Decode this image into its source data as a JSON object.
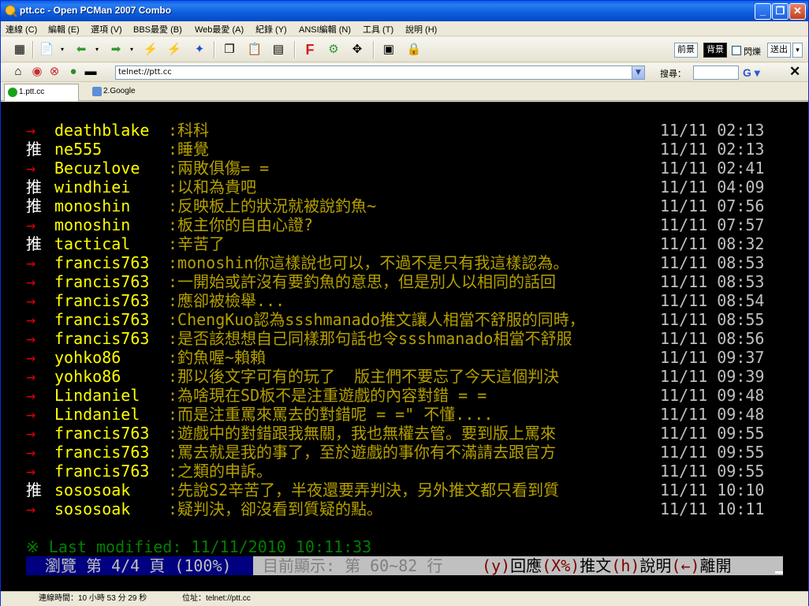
{
  "window": {
    "title": "ptt.cc - Open PCMan 2007 Combo"
  },
  "menu": [
    "連線 (C)",
    "編輯 (E)",
    "選項 (V)",
    "BBS最愛 (B)",
    "Web最愛 (A)",
    "紀錄 (Y)",
    "ANSI編輯 (N)",
    "工具 (T)",
    "說明 (H)"
  ],
  "toolbar": {
    "front_label": "前景",
    "back_label": "背景",
    "blink_label": "閃爍",
    "send_label": "送出"
  },
  "address": {
    "value": "telnet://ptt.cc",
    "search_label": "搜尋：",
    "search_value": ""
  },
  "tabs": [
    {
      "label": "1.ptt.cc",
      "active": true
    },
    {
      "label": "2.Google",
      "active": false
    }
  ],
  "terminal": {
    "rows": [
      {
        "tag": "→",
        "tag_type": "arrow",
        "user": "deathblake",
        "msg": ":科科",
        "time": "11/11 02:13"
      },
      {
        "tag": "推",
        "tag_type": "push",
        "user": "ne555",
        "msg": ":睡覺",
        "time": "11/11 02:13"
      },
      {
        "tag": "→",
        "tag_type": "arrow",
        "user": "Becuzlove",
        "msg": ":兩敗俱傷= =",
        "time": "11/11 02:41"
      },
      {
        "tag": "推",
        "tag_type": "push",
        "user": "windhiei",
        "msg": ":以和為貴吧",
        "time": "11/11 04:09"
      },
      {
        "tag": "推",
        "tag_type": "push",
        "user": "monoshin",
        "msg": ":反映板上的狀況就被說釣魚~",
        "time": "11/11 07:56"
      },
      {
        "tag": "→",
        "tag_type": "arrow",
        "user": "monoshin",
        "msg": ":板主你的自由心證?",
        "time": "11/11 07:57"
      },
      {
        "tag": "推",
        "tag_type": "push",
        "user": "tactical",
        "msg": ":辛苦了",
        "time": "11/11 08:32"
      },
      {
        "tag": "→",
        "tag_type": "arrow",
        "user": "francis763",
        "msg": ":monoshin你這樣說也可以，不過不是只有我這樣認為。",
        "time": "11/11 08:53"
      },
      {
        "tag": "→",
        "tag_type": "arrow",
        "user": "francis763",
        "msg": ":一開始或許沒有要釣魚的意思，但是別人以相同的話回",
        "time": "11/11 08:53"
      },
      {
        "tag": "→",
        "tag_type": "arrow",
        "user": "francis763",
        "msg": ":應卻被檢舉...",
        "time": "11/11 08:54"
      },
      {
        "tag": "→",
        "tag_type": "arrow",
        "user": "francis763",
        "msg": ":ChengKuo認為ssshmanado推文讓人相當不舒服的同時，",
        "time": "11/11 08:55"
      },
      {
        "tag": "→",
        "tag_type": "arrow",
        "user": "francis763",
        "msg": ":是否該想想自己同樣那句話也令ssshmanado相當不舒服",
        "time": "11/11 08:56"
      },
      {
        "tag": "→",
        "tag_type": "arrow",
        "user": "yohko86",
        "msg": ":釣魚喔~賴賴",
        "time": "11/11 09:37"
      },
      {
        "tag": "→",
        "tag_type": "arrow",
        "user": "yohko86",
        "msg": ":那以後文字可有的玩了  版主們不要忘了今天這個判決",
        "time": "11/11 09:39"
      },
      {
        "tag": "→",
        "tag_type": "arrow",
        "user": "Lindaniel",
        "msg": ":為啥現在SD板不是注重遊戲的內容對錯 = =",
        "time": "11/11 09:48"
      },
      {
        "tag": "→",
        "tag_type": "arrow",
        "user": "Lindaniel",
        "msg": ":而是注重罵來罵去的對錯呢 = =\" 不懂....",
        "time": "11/11 09:48"
      },
      {
        "tag": "→",
        "tag_type": "arrow",
        "user": "francis763",
        "msg": ":遊戲中的對錯跟我無關，我也無權去管。要到版上罵來",
        "time": "11/11 09:55"
      },
      {
        "tag": "→",
        "tag_type": "arrow",
        "user": "francis763",
        "msg": ":罵去就是我的事了，至於遊戲的事你有不滿請去跟官方",
        "time": "11/11 09:55"
      },
      {
        "tag": "→",
        "tag_type": "arrow",
        "user": "francis763",
        "msg": ":之類的申訴。",
        "time": "11/11 09:55"
      },
      {
        "tag": "推",
        "tag_type": "push",
        "user": "sososoak",
        "msg": ":先說S2辛苦了，半夜還要弄判決，另外推文都只看到質",
        "time": "11/11 10:10"
      },
      {
        "tag": "→",
        "tag_type": "arrow",
        "user": "sososoak",
        "msg": ":疑判決，卻沒看到質疑的點。",
        "time": "11/11 10:11"
      }
    ],
    "last_modified": "※ Last modified: 11/11/2010 10:11:33",
    "footer": {
      "browse": "瀏覽 第 4/4 頁 (100%)",
      "showing": "目前顯示: 第 60~82 行",
      "key_y": "(y)",
      "reply": "回應",
      "key_x": "(X%)",
      "push": "推文",
      "key_h": "(h)",
      "help": "說明",
      "key_left": "(←)",
      "leave": "離開"
    }
  },
  "status": {
    "connect_time": "連線時間：10 小時 53 分 29 秒",
    "location": "位址：telnet://ptt.cc"
  },
  "colors": {
    "terminal_bg": "#000000",
    "user": "#ffff00",
    "message": "#b5a000",
    "arrow": "#e00000",
    "push": "#ffffff",
    "footer_bg": "#000080"
  }
}
